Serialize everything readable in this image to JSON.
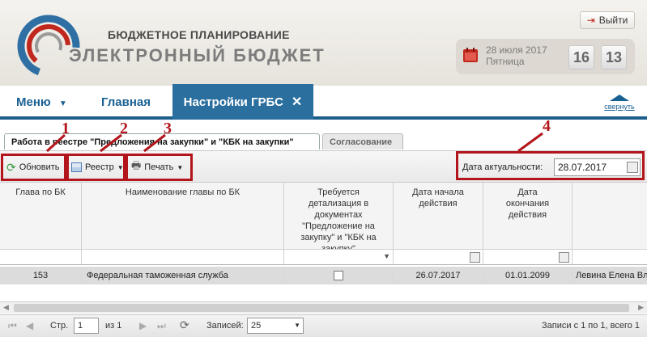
{
  "header": {
    "brand_top": "БЮДЖЕТНОЕ ПЛАНИРОВАНИЕ",
    "brand_bottom": "ЭЛЕКТРОННЫЙ БЮДЖЕТ",
    "logout_label": "Выйти",
    "date": "28 июля 2017",
    "weekday": "Пятница",
    "clock_hours": "16",
    "clock_minutes": "13"
  },
  "menu": {
    "menu_label": "Меню",
    "home_label": "Главная",
    "active_tab": "Настройки ГРБС",
    "collapse_label": "свернуть"
  },
  "subtabs": [
    "Работа в реестре \"Предложения на закупки\" и \"КБК на закупки\"",
    "Согласование"
  ],
  "toolbar": {
    "refresh_label": "Обновить",
    "registry_label": "Реестр",
    "print_label": "Печать",
    "actual_date_label": "Дата актуальности:",
    "actual_date_value": "28.07.2017"
  },
  "annotations": [
    "1",
    "2",
    "3",
    "4"
  ],
  "table": {
    "columns": [
      "Глава по БК",
      "Наименование главы по БК",
      "Требуется детализация в документах \"Предложение на закупку\" и \"КБК на закупку\"",
      "Дата начала действия",
      "Дата окончания действия"
    ],
    "rows": [
      {
        "code": "153",
        "name": "Федеральная таможенная служба",
        "detail_required": false,
        "start": "26.07.2017",
        "end": "01.01.2099",
        "user": "Левина Елена Вл"
      }
    ]
  },
  "pager": {
    "page_label": "Стр.",
    "page_value": "1",
    "of_label": "из 1",
    "records_label": "Записей:",
    "records_value": "25",
    "summary": "Записи с 1 по 1, всего 1"
  },
  "colors": {
    "accent": "#2b6f9e",
    "annotation_red": "#b3151c",
    "link": "#1a6193"
  }
}
